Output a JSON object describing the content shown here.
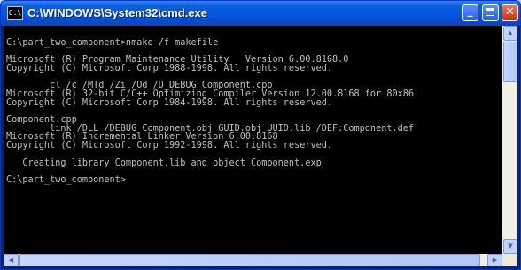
{
  "window": {
    "title": "C:\\WINDOWS\\System32\\cmd.exe",
    "icon": "cmd-icon",
    "icon_glyph": "C:\\",
    "buttons": {
      "minimize": "_",
      "close": "✕"
    }
  },
  "console": {
    "lines": [
      "",
      "C:\\part_two_component>nmake /f makefile",
      "",
      "Microsoft (R) Program Maintenance Utility   Version 6.00.8168.0",
      "Copyright (C) Microsoft Corp 1988-1998. All rights reserved.",
      "",
      "        cl /c /MTd /Zi /Od /D_DEBUG Component.cpp",
      "Microsoft (R) 32-bit C/C++ Optimizing Compiler Version 12.00.8168 for 80x86",
      "Copyright (C) Microsoft Corp 1984-1998. All rights reserved.",
      "",
      "Component.cpp",
      "        link /DLL /DEBUG Component.obj GUID.obj UUID.lib /DEF:Component.def",
      "Microsoft (R) Incremental Linker Version 6.00.8168",
      "Copyright (C) Microsoft Corp 1992-1998. All rights reserved.",
      "",
      "   Creating library Component.lib and object Component.exp",
      "",
      "C:\\part_two_component>"
    ]
  },
  "scrollbars": {
    "up": "▲",
    "down": "▼",
    "left": "◀",
    "right": "▶"
  }
}
